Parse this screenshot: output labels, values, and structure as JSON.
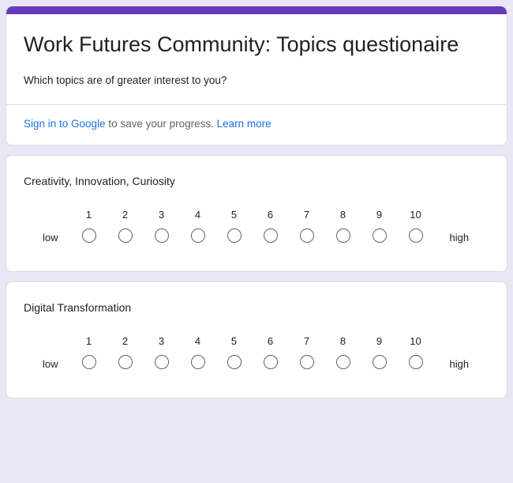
{
  "theme": {
    "accent_color": "#673ab7",
    "page_background": "#e9e6f6",
    "card_background": "#ffffff",
    "link_color": "#1a73e8",
    "text_color": "#202124",
    "radio_border_color": "#5f6368"
  },
  "header": {
    "title": "Work Futures Community: Topics questionaire",
    "description": "Which topics are of greater interest to you?",
    "signin": {
      "link_label": "Sign in to Google",
      "middle_text": " to save your progress. ",
      "learn_more_label": "Learn more"
    }
  },
  "questions": [
    {
      "title": "Creativity, Innovation, Curiosity",
      "low_label": "low",
      "high_label": "high",
      "options": [
        "1",
        "2",
        "3",
        "4",
        "5",
        "6",
        "7",
        "8",
        "9",
        "10"
      ],
      "selected": null
    },
    {
      "title": "Digital Transformation",
      "low_label": "low",
      "high_label": "high",
      "options": [
        "1",
        "2",
        "3",
        "4",
        "5",
        "6",
        "7",
        "8",
        "9",
        "10"
      ],
      "selected": null
    }
  ]
}
